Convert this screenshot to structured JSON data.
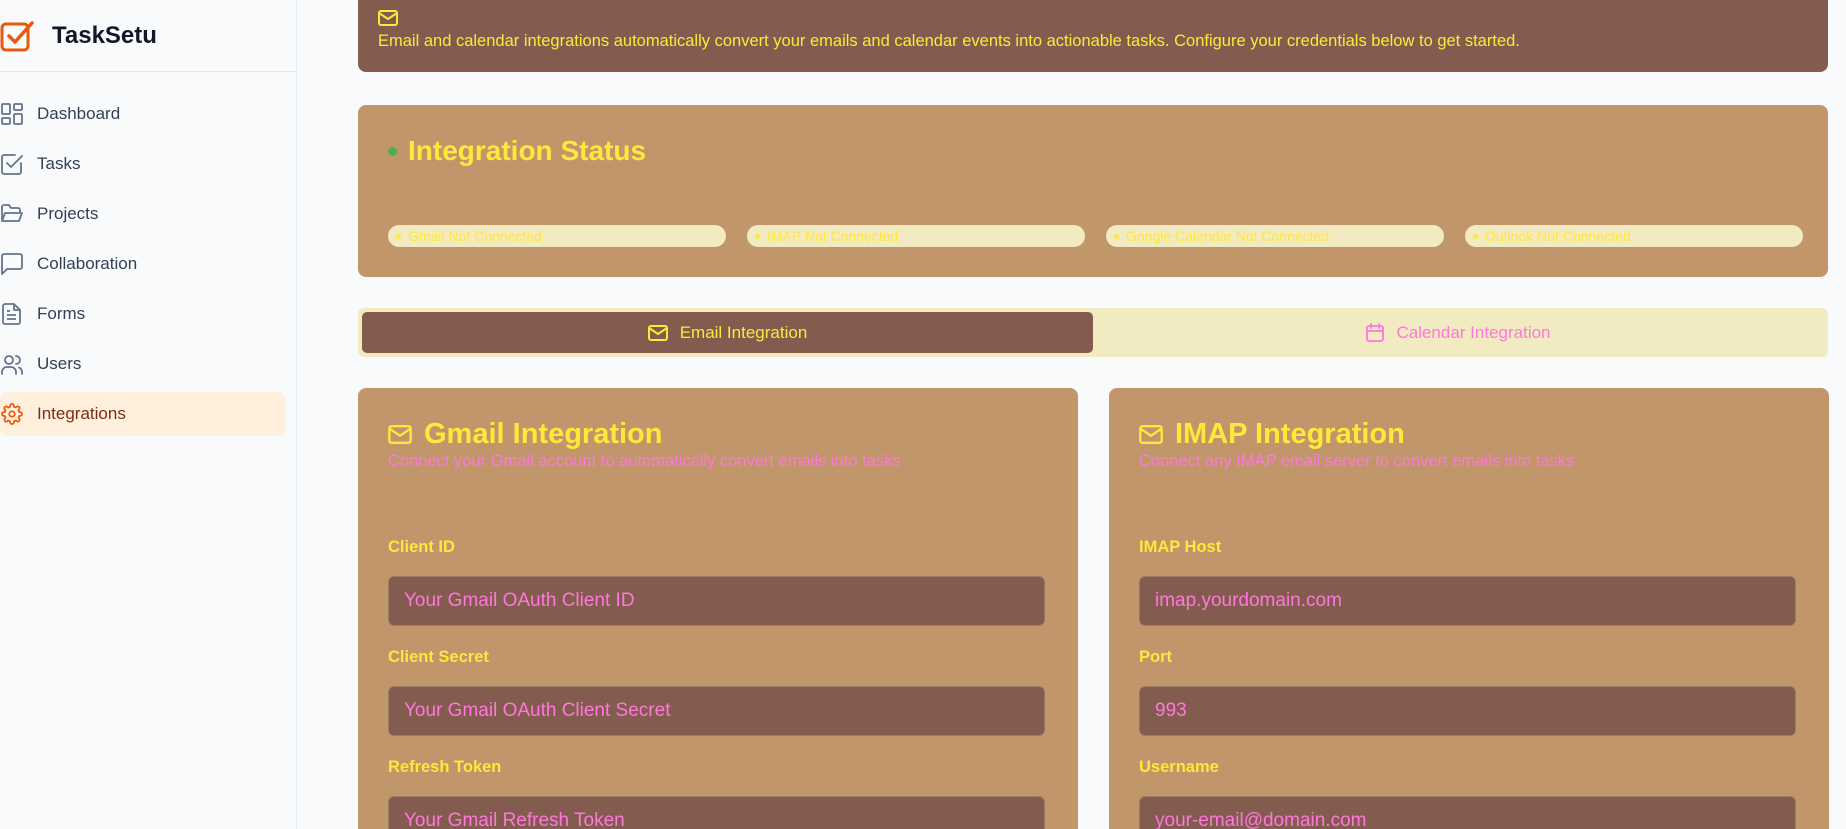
{
  "brand": {
    "name": "TaskSetu"
  },
  "sidebar": {
    "items": [
      {
        "label": "Dashboard",
        "icon": "dashboard-icon"
      },
      {
        "label": "Tasks",
        "icon": "check-square-icon"
      },
      {
        "label": "Projects",
        "icon": "folder-open-icon"
      },
      {
        "label": "Collaboration",
        "icon": "message-square-icon"
      },
      {
        "label": "Forms",
        "icon": "file-text-icon"
      },
      {
        "label": "Users",
        "icon": "users-icon"
      },
      {
        "label": "Integrations",
        "icon": "gear-icon",
        "active": true
      }
    ]
  },
  "banner": {
    "text": "Email and calendar integrations automatically convert your emails and calendar events into actionable tasks. Configure your credentials below to get started."
  },
  "status": {
    "title": "Integration Status",
    "pills": [
      "Gmail Not Connected",
      "IMAP Not Connected",
      "Google Calendar Not Connected",
      "Outlook Not Connected"
    ]
  },
  "tabs": [
    {
      "label": "Email Integration",
      "active": true
    },
    {
      "label": "Calendar Integration",
      "active": false
    }
  ],
  "gmail": {
    "title": "Gmail Integration",
    "subtitle": "Connect your Gmail account to automatically convert emails into tasks",
    "fields": [
      {
        "label": "Client ID",
        "placeholder": "Your Gmail OAuth Client ID"
      },
      {
        "label": "Client Secret",
        "placeholder": "Your Gmail OAuth Client Secret"
      },
      {
        "label": "Refresh Token",
        "placeholder": "Your Gmail Refresh Token"
      }
    ]
  },
  "imap": {
    "title": "IMAP Integration",
    "subtitle": "Connect any IMAP email server to convert emails into tasks",
    "fields": [
      {
        "label": "IMAP Host",
        "placeholder": "imap.yourdomain.com"
      },
      {
        "label": "Port",
        "placeholder": "993"
      },
      {
        "label": "Username",
        "placeholder": "your-email@domain.com"
      }
    ]
  },
  "colors": {
    "accent": "#ea580c",
    "card": "#c1966b",
    "dark": "#845c4f",
    "yellow": "#ffe83a",
    "pink": "#ff77dd"
  }
}
